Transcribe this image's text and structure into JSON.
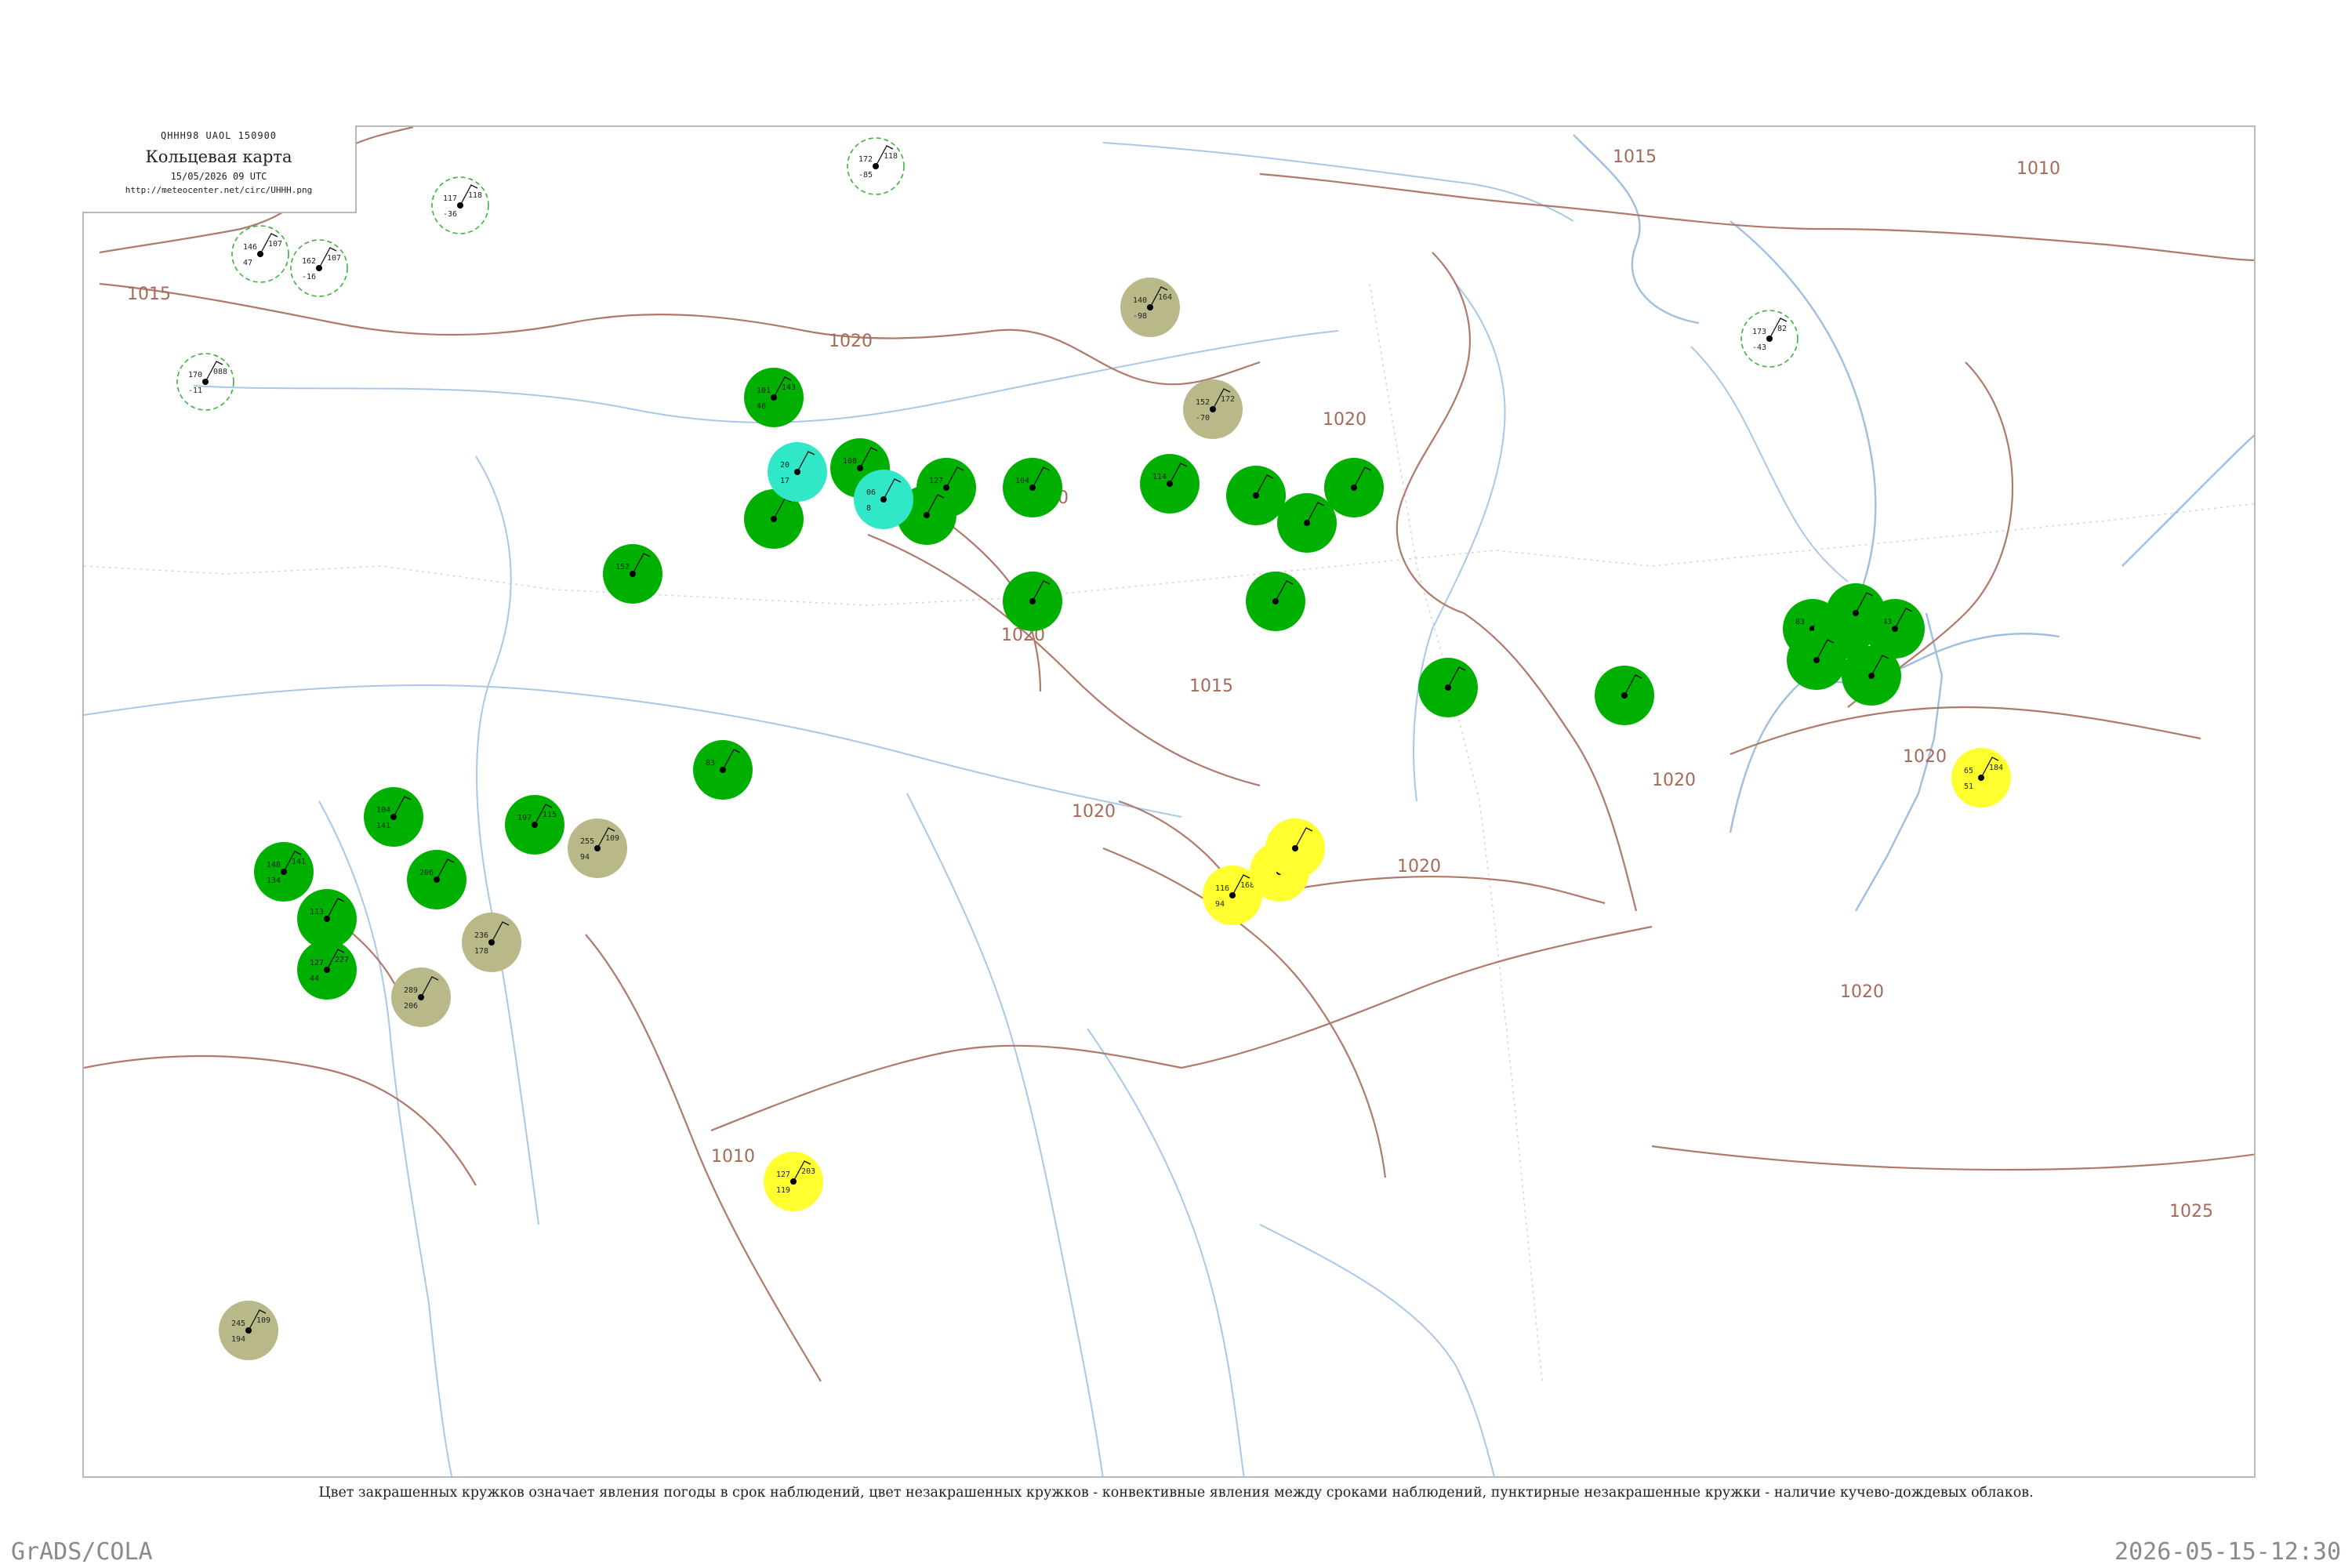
{
  "header": {
    "codes": "QHHH98  UAOL  150900",
    "title": "Кольцевая карта",
    "datetime": "15/05/2026 09 UTC",
    "url": "http://meteocenter.net/circ/UHHH.png"
  },
  "caption": "Цвет закрашенных кружков означает явления погоды в срок наблюдений, цвет незакрашенных кружков - конвективные явления между сроками наблюдений, пунктирные незакрашенные кружки - наличие кучево-дождевых облаков.",
  "footer": {
    "left": "GrADS/COLA",
    "right": "2026-05-15-12:30"
  },
  "colors": {
    "isobar": "#b07a6a",
    "river": "#a7c8e8",
    "rain_green": "#00b000",
    "cyan": "#30e8c8",
    "yellow": "#ffff30",
    "khaki": "#b8b888",
    "cb_ring": "#3cb43c"
  },
  "isobar_labels": [
    {
      "text": "1015"
    },
    {
      "text": "1010"
    },
    {
      "text": "1015"
    },
    {
      "text": "1020"
    },
    {
      "text": "1020"
    },
    {
      "text": "1015"
    },
    {
      "text": "1020"
    },
    {
      "text": "1020"
    },
    {
      "text": "1020"
    },
    {
      "text": "1020"
    },
    {
      "text": "1020"
    },
    {
      "text": "1025"
    },
    {
      "text": "1010"
    },
    {
      "text": "1020"
    },
    {
      "text": "1020"
    }
  ],
  "stations": [
    {
      "fill": "ring",
      "t": "146",
      "d": "47",
      "p": "107",
      "id": ""
    },
    {
      "fill": "ring",
      "t": "162",
      "d": "-16",
      "p": "107",
      "id": ""
    },
    {
      "fill": "ring",
      "t": "117",
      "d": "-36",
      "p": "118",
      "id": ""
    },
    {
      "fill": "ring",
      "t": "170",
      "d": "-11",
      "p": "088",
      "id": ""
    },
    {
      "fill": "ring",
      "t": "172",
      "d": "-85",
      "p": "118",
      "id": ""
    },
    {
      "fill": "ring",
      "t": "173",
      "d": "-43",
      "p": "82",
      "id": ""
    },
    {
      "fill": "green",
      "t": "101",
      "d": "40",
      "p": "143",
      "id": ""
    },
    {
      "fill": "green",
      "t": "148",
      "d": "134",
      "p": "141",
      "id": ""
    },
    {
      "fill": "green",
      "t": "127",
      "d": "44",
      "p": "227",
      "id": ""
    },
    {
      "fill": "green",
      "t": "104",
      "d": "141",
      "p": "",
      "id": ""
    },
    {
      "fill": "green",
      "t": "206",
      "d": "",
      "p": "",
      "id": ""
    },
    {
      "fill": "green",
      "t": "197",
      "d": "",
      "p": "115",
      "id": ""
    },
    {
      "fill": "green",
      "t": "113",
      "d": "",
      "p": "",
      "id": ""
    },
    {
      "fill": "green",
      "t": "83",
      "d": "",
      "p": "103",
      "id": ""
    },
    {
      "fill": "green",
      "t": "139",
      "d": "",
      "p": "",
      "id": ""
    },
    {
      "fill": "green",
      "t": "143",
      "d": "",
      "p": "",
      "id": ""
    },
    {
      "fill": "green",
      "t": "152",
      "d": "",
      "p": "",
      "id": ""
    },
    {
      "fill": "green",
      "t": "83",
      "d": "",
      "p": "",
      "id": ""
    },
    {
      "fill": "green",
      "t": "108",
      "d": "",
      "p": "",
      "id": ""
    },
    {
      "fill": "green",
      "t": "127",
      "d": "",
      "p": "",
      "id": ""
    },
    {
      "fill": "green",
      "t": "104",
      "d": "",
      "p": "",
      "id": ""
    },
    {
      "fill": "green",
      "t": "114",
      "d": "",
      "p": "",
      "id": ""
    },
    {
      "fill": "green",
      "t": "",
      "d": "",
      "p": "",
      "id": ""
    },
    {
      "fill": "green",
      "t": "",
      "d": "",
      "p": "",
      "id": ""
    },
    {
      "fill": "green",
      "t": "",
      "d": "",
      "p": "",
      "id": ""
    },
    {
      "fill": "green",
      "t": "",
      "d": "",
      "p": "",
      "id": ""
    },
    {
      "fill": "green",
      "t": "",
      "d": "",
      "p": "",
      "id": ""
    },
    {
      "fill": "green",
      "t": "",
      "d": "",
      "p": "",
      "id": ""
    },
    {
      "fill": "green",
      "t": "",
      "d": "",
      "p": "",
      "id": ""
    },
    {
      "fill": "green",
      "t": "",
      "d": "",
      "p": "",
      "id": ""
    },
    {
      "fill": "green",
      "t": "",
      "d": "",
      "p": "",
      "id": ""
    },
    {
      "fill": "green",
      "t": "",
      "d": "",
      "p": "",
      "id": ""
    },
    {
      "fill": "green",
      "t": "",
      "d": "",
      "p": "",
      "id": ""
    },
    {
      "fill": "green",
      "t": "",
      "d": "",
      "p": "",
      "id": ""
    },
    {
      "fill": "cyan",
      "t": "20",
      "d": "17",
      "p": "",
      "id": ""
    },
    {
      "fill": "cyan",
      "t": "06",
      "d": "8",
      "p": "",
      "id": ""
    },
    {
      "fill": "khaki",
      "t": "140",
      "d": "-98",
      "p": "164",
      "id": ""
    },
    {
      "fill": "khaki",
      "t": "152",
      "d": "-70",
      "p": "172",
      "id": ""
    },
    {
      "fill": "khaki",
      "t": "255",
      "d": "94",
      "p": "109",
      "id": ""
    },
    {
      "fill": "khaki",
      "t": "236",
      "d": "178",
      "p": "",
      "id": ""
    },
    {
      "fill": "khaki",
      "t": "289",
      "d": "206",
      "p": "",
      "id": ""
    },
    {
      "fill": "khaki",
      "t": "245",
      "d": "194",
      "p": "109",
      "id": ""
    },
    {
      "fill": "yellow",
      "t": "127",
      "d": "119",
      "p": "203",
      "id": ""
    },
    {
      "fill": "yellow",
      "t": "116",
      "d": "94",
      "p": "168",
      "id": ""
    },
    {
      "fill": "yellow",
      "t": "",
      "d": "",
      "p": "167",
      "id": ""
    },
    {
      "fill": "yellow",
      "t": "",
      "d": "",
      "p": "",
      "id": ""
    },
    {
      "fill": "yellow",
      "t": "65",
      "d": "51",
      "p": "184",
      "id": ""
    }
  ]
}
